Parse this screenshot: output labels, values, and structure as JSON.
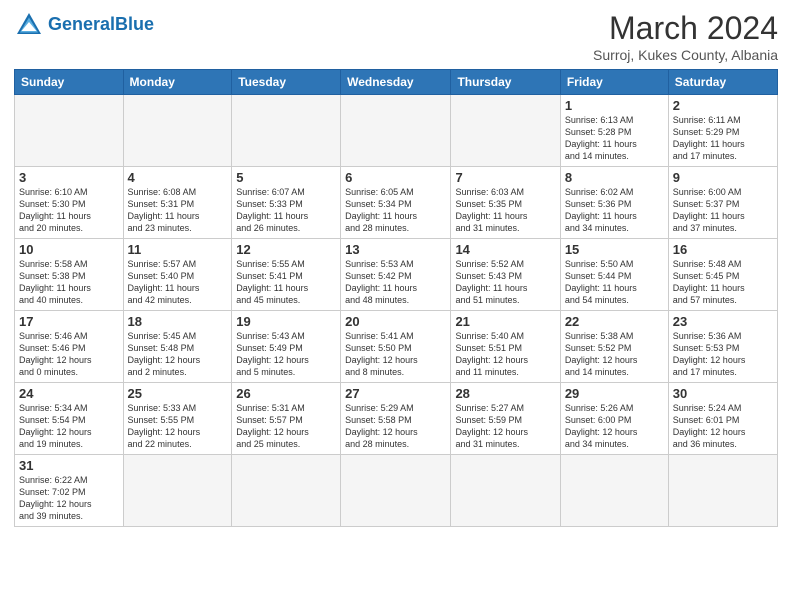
{
  "logo": {
    "text_general": "General",
    "text_blue": "Blue"
  },
  "header": {
    "month_year": "March 2024",
    "location": "Surroj, Kukes County, Albania"
  },
  "weekdays": [
    "Sunday",
    "Monday",
    "Tuesday",
    "Wednesday",
    "Thursday",
    "Friday",
    "Saturday"
  ],
  "weeks": [
    [
      {
        "day": "",
        "info": ""
      },
      {
        "day": "",
        "info": ""
      },
      {
        "day": "",
        "info": ""
      },
      {
        "day": "",
        "info": ""
      },
      {
        "day": "",
        "info": ""
      },
      {
        "day": "1",
        "info": "Sunrise: 6:13 AM\nSunset: 5:28 PM\nDaylight: 11 hours\nand 14 minutes."
      },
      {
        "day": "2",
        "info": "Sunrise: 6:11 AM\nSunset: 5:29 PM\nDaylight: 11 hours\nand 17 minutes."
      }
    ],
    [
      {
        "day": "3",
        "info": "Sunrise: 6:10 AM\nSunset: 5:30 PM\nDaylight: 11 hours\nand 20 minutes."
      },
      {
        "day": "4",
        "info": "Sunrise: 6:08 AM\nSunset: 5:31 PM\nDaylight: 11 hours\nand 23 minutes."
      },
      {
        "day": "5",
        "info": "Sunrise: 6:07 AM\nSunset: 5:33 PM\nDaylight: 11 hours\nand 26 minutes."
      },
      {
        "day": "6",
        "info": "Sunrise: 6:05 AM\nSunset: 5:34 PM\nDaylight: 11 hours\nand 28 minutes."
      },
      {
        "day": "7",
        "info": "Sunrise: 6:03 AM\nSunset: 5:35 PM\nDaylight: 11 hours\nand 31 minutes."
      },
      {
        "day": "8",
        "info": "Sunrise: 6:02 AM\nSunset: 5:36 PM\nDaylight: 11 hours\nand 34 minutes."
      },
      {
        "day": "9",
        "info": "Sunrise: 6:00 AM\nSunset: 5:37 PM\nDaylight: 11 hours\nand 37 minutes."
      }
    ],
    [
      {
        "day": "10",
        "info": "Sunrise: 5:58 AM\nSunset: 5:38 PM\nDaylight: 11 hours\nand 40 minutes."
      },
      {
        "day": "11",
        "info": "Sunrise: 5:57 AM\nSunset: 5:40 PM\nDaylight: 11 hours\nand 42 minutes."
      },
      {
        "day": "12",
        "info": "Sunrise: 5:55 AM\nSunset: 5:41 PM\nDaylight: 11 hours\nand 45 minutes."
      },
      {
        "day": "13",
        "info": "Sunrise: 5:53 AM\nSunset: 5:42 PM\nDaylight: 11 hours\nand 48 minutes."
      },
      {
        "day": "14",
        "info": "Sunrise: 5:52 AM\nSunset: 5:43 PM\nDaylight: 11 hours\nand 51 minutes."
      },
      {
        "day": "15",
        "info": "Sunrise: 5:50 AM\nSunset: 5:44 PM\nDaylight: 11 hours\nand 54 minutes."
      },
      {
        "day": "16",
        "info": "Sunrise: 5:48 AM\nSunset: 5:45 PM\nDaylight: 11 hours\nand 57 minutes."
      }
    ],
    [
      {
        "day": "17",
        "info": "Sunrise: 5:46 AM\nSunset: 5:46 PM\nDaylight: 12 hours\nand 0 minutes."
      },
      {
        "day": "18",
        "info": "Sunrise: 5:45 AM\nSunset: 5:48 PM\nDaylight: 12 hours\nand 2 minutes."
      },
      {
        "day": "19",
        "info": "Sunrise: 5:43 AM\nSunset: 5:49 PM\nDaylight: 12 hours\nand 5 minutes."
      },
      {
        "day": "20",
        "info": "Sunrise: 5:41 AM\nSunset: 5:50 PM\nDaylight: 12 hours\nand 8 minutes."
      },
      {
        "day": "21",
        "info": "Sunrise: 5:40 AM\nSunset: 5:51 PM\nDaylight: 12 hours\nand 11 minutes."
      },
      {
        "day": "22",
        "info": "Sunrise: 5:38 AM\nSunset: 5:52 PM\nDaylight: 12 hours\nand 14 minutes."
      },
      {
        "day": "23",
        "info": "Sunrise: 5:36 AM\nSunset: 5:53 PM\nDaylight: 12 hours\nand 17 minutes."
      }
    ],
    [
      {
        "day": "24",
        "info": "Sunrise: 5:34 AM\nSunset: 5:54 PM\nDaylight: 12 hours\nand 19 minutes."
      },
      {
        "day": "25",
        "info": "Sunrise: 5:33 AM\nSunset: 5:55 PM\nDaylight: 12 hours\nand 22 minutes."
      },
      {
        "day": "26",
        "info": "Sunrise: 5:31 AM\nSunset: 5:57 PM\nDaylight: 12 hours\nand 25 minutes."
      },
      {
        "day": "27",
        "info": "Sunrise: 5:29 AM\nSunset: 5:58 PM\nDaylight: 12 hours\nand 28 minutes."
      },
      {
        "day": "28",
        "info": "Sunrise: 5:27 AM\nSunset: 5:59 PM\nDaylight: 12 hours\nand 31 minutes."
      },
      {
        "day": "29",
        "info": "Sunrise: 5:26 AM\nSunset: 6:00 PM\nDaylight: 12 hours\nand 34 minutes."
      },
      {
        "day": "30",
        "info": "Sunrise: 5:24 AM\nSunset: 6:01 PM\nDaylight: 12 hours\nand 36 minutes."
      }
    ],
    [
      {
        "day": "31",
        "info": "Sunrise: 6:22 AM\nSunset: 7:02 PM\nDaylight: 12 hours\nand 39 minutes."
      },
      {
        "day": "",
        "info": ""
      },
      {
        "day": "",
        "info": ""
      },
      {
        "day": "",
        "info": ""
      },
      {
        "day": "",
        "info": ""
      },
      {
        "day": "",
        "info": ""
      },
      {
        "day": "",
        "info": ""
      }
    ]
  ]
}
